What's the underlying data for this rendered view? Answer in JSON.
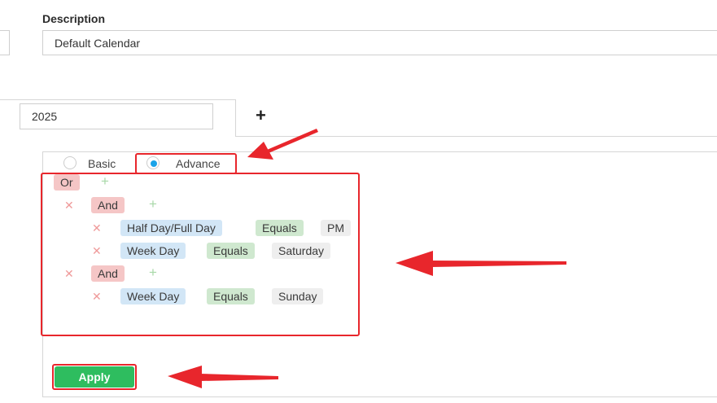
{
  "description": {
    "label": "Description",
    "value": "Default Calendar"
  },
  "year_tab": {
    "value": "2025",
    "add_tab_label": "+"
  },
  "mode": {
    "basic_label": "Basic",
    "advance_label": "Advance",
    "selected": "Advance"
  },
  "rules": {
    "root_operator": "Or",
    "groups": [
      {
        "operator": "And",
        "conditions": [
          {
            "field": "Half Day/Full Day",
            "op": "Equals",
            "value": "PM"
          },
          {
            "field": "Week Day",
            "op": "Equals",
            "value": "Saturday"
          }
        ]
      },
      {
        "operator": "And",
        "conditions": [
          {
            "field": "Week Day",
            "op": "Equals",
            "value": "Sunday"
          }
        ]
      }
    ]
  },
  "apply_label": "Apply",
  "icons": {
    "add": "+",
    "remove": "✕"
  },
  "colors": {
    "highlight": "#e8262c",
    "apply_green": "#2ebd5f",
    "radio_selected": "#1aa3e8",
    "operator_tag": "#f5c6c6",
    "field_tag": "#d2e6f6",
    "op_tag": "#cfe8cf",
    "value_tag": "#eeeeee"
  }
}
